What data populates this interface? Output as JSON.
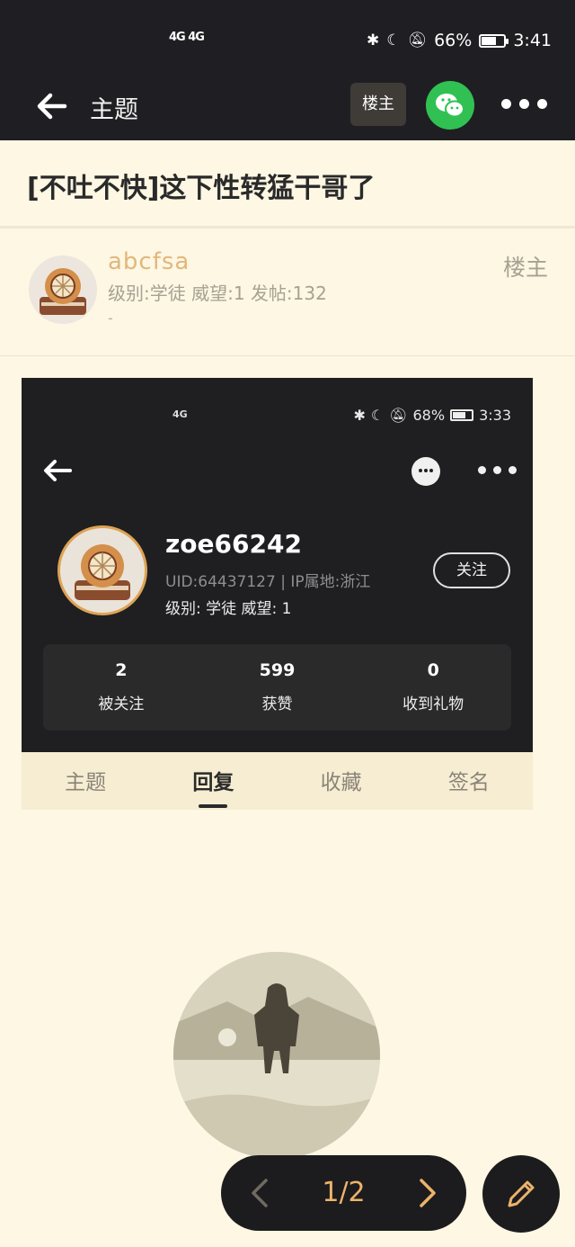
{
  "status_bar": {
    "network": "4G 4G",
    "battery": "66%",
    "time": "3:41"
  },
  "app_bar": {
    "title": "主题",
    "owner_chip": "楼主"
  },
  "topic": {
    "title": "[不吐不快]这下性转猛干哥了"
  },
  "author": {
    "name": "abcfsa",
    "meta": "级别:学徒 威望:1 发帖:132",
    "signature": "-",
    "badge": "楼主"
  },
  "embedded_image": {
    "status": {
      "network": "4G",
      "battery": "68%",
      "time": "3:33"
    },
    "profile": {
      "username": "zoe66242",
      "uid_line": "UID:64437127 | IP属地:浙江",
      "level_line": "级别: 学徒  威望: 1",
      "follow_label": "关注"
    },
    "stats": [
      {
        "num": "2",
        "label": "被关注"
      },
      {
        "num": "599",
        "label": "获赞"
      },
      {
        "num": "0",
        "label": "收到礼物"
      }
    ],
    "tabs": [
      "主题",
      "回复",
      "收藏",
      "签名"
    ]
  },
  "pager": {
    "text": "1/2"
  },
  "icons": [
    "back-arrow-icon",
    "wechat-icon",
    "more-icon",
    "chevron-left-icon",
    "chevron-right-icon",
    "pencil-icon"
  ],
  "colors": {
    "bar_bg": "#1f1f23",
    "page_bg": "#fdf7e3",
    "accent": "#ecb36a",
    "wechat": "#31c152"
  }
}
